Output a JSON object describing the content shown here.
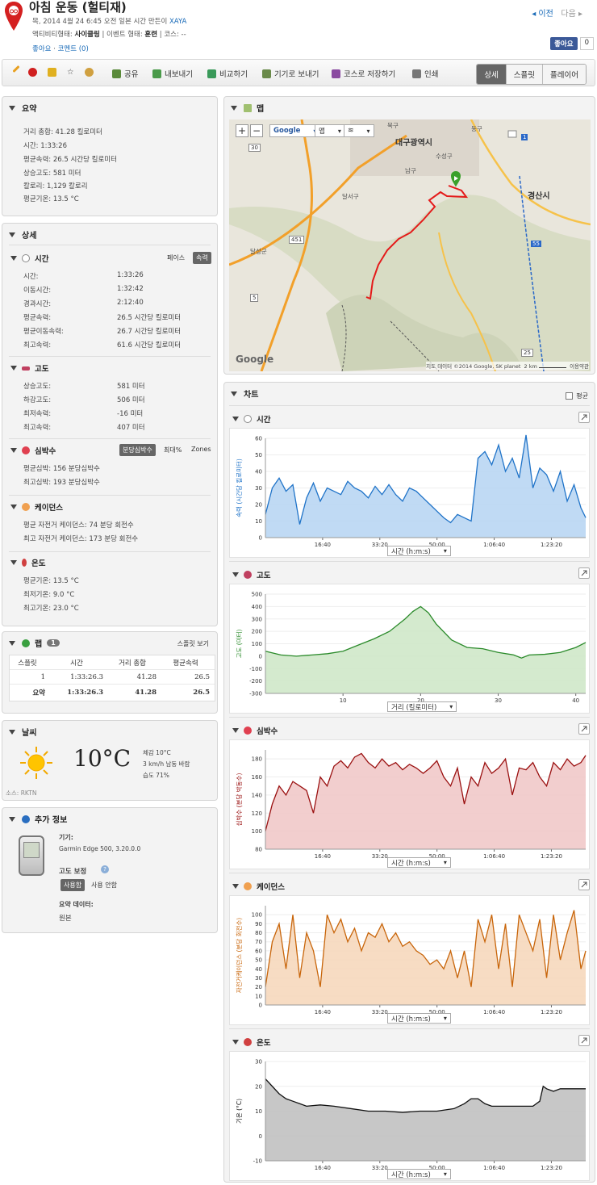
{
  "header": {
    "title": "아침 운동 (헐티재)",
    "date_line": "목, 2014 4월 24 6:45 오전 일본 시간 만든이 ",
    "author": "XAYA",
    "activity_label": "액티비티형태: ",
    "activity": "사이클링",
    "event_label": " | 이벤트 형태: ",
    "event": "훈련",
    "course": " | 코스: --",
    "like": "좋아요",
    "comments": "코멘트 (0)",
    "prev": "◂ 이전",
    "next": "다음 ▸",
    "fb_like": "좋아요",
    "fb_count": "0"
  },
  "toolbar": {
    "share": "공유",
    "export": "내보내기",
    "compare": "비교하기",
    "send": "기기로 보내기",
    "save_course": "코스로 저장하기",
    "print": "인쇄",
    "tabs": [
      "상세",
      "스플릿",
      "플레이어"
    ]
  },
  "summary": {
    "title": "요약",
    "rows": [
      "거리 총합:  41.28 킬로미터",
      "시간:  1:33:26",
      "평균속력:  26.5 시간당 킬로미터",
      "상승고도:  581 미터",
      "칼로리:  1,129 칼로리",
      "평균기온:  13.5 °C"
    ]
  },
  "detail": {
    "title": "상세",
    "time": {
      "title": "시간",
      "pace": "페이스",
      "speed": "속력",
      "labels": [
        "시간:",
        "이동시간:",
        "경과시간:",
        "평균속력:",
        "평균이동속력:",
        "최고속력:"
      ],
      "values": [
        "1:33:26",
        "1:32:42",
        "2:12:40",
        "26.5 시간당 킬로미터",
        "26.7 시간당 킬로미터",
        "61.6 시간당 킬로미터"
      ]
    },
    "elev": {
      "title": "고도",
      "labels": [
        "상승고도:",
        "하강고도:",
        "최저속력:",
        "최고속력:"
      ],
      "values": [
        "581 미터",
        "506 미터",
        "-16 미터",
        "407 미터"
      ]
    },
    "hr": {
      "title": "심박수",
      "bpm": "분당심박수",
      "max": "최대%",
      "zones": "Zones",
      "rows": [
        "평균심박:  156 분당심박수",
        "최고심박:  193 분당심박수"
      ]
    },
    "cad": {
      "title": "케이던스",
      "rows": [
        "평균 자전거 케이던스:  74 분당 회전수",
        "최고 자전거 케이던스:  173 분당 회전수"
      ]
    },
    "temp": {
      "title": "온도",
      "rows": [
        "평균기온:  13.5 °C",
        "최저기온:  9.0 °C",
        "최고기온:  23.0 °C"
      ]
    }
  },
  "laps": {
    "title": "랩",
    "count": "1",
    "split_view": "스플릿 보기",
    "headers": [
      "스플릿",
      "시간",
      "거리 총합",
      "평균속력"
    ],
    "row": [
      "1",
      "1:33:26.3",
      "41.28",
      "26.5"
    ],
    "total": [
      "요약",
      "1:33:26.3",
      "41.28",
      "26.5"
    ]
  },
  "weather": {
    "title": "날씨",
    "temp": "10°C",
    "feels": "체감 10°C",
    "wind": "3 km/h 남동 바람",
    "humidity": "습도 71%",
    "source": "소스: RKTN"
  },
  "extra": {
    "title": "추가 정보",
    "device_label": "기기:",
    "device": "Garmin Edge 500, 3.20.0.0",
    "elev_corr": "고도 보정",
    "use": "사용함",
    "nouse": "사용 안함",
    "summary_data": "요약 데이터:",
    "original": "원본"
  },
  "map": {
    "title": "맵",
    "google": "Google",
    "map_btn": "맵",
    "city": "대구광역시",
    "city2": "경산시",
    "copyright": "지도 데이터 ©2014 Google, SK planet",
    "scale": "2 km",
    "terms": "이용약관",
    "logo": "Google",
    "places": [
      "북구",
      "수성구",
      "남구",
      "달서구",
      "달성군",
      "동구"
    ],
    "roads": [
      "451",
      "30",
      "55",
      "5",
      "25",
      "1"
    ]
  },
  "charts": {
    "title": "차트",
    "avg": "평균",
    "speed": {
      "title": "시간",
      "ylabel": "속력 (시간당 킬로미터)",
      "xlabel": "시간 (h:m:s)"
    },
    "elev": {
      "title": "고도",
      "ylabel": "고도 (미터)",
      "xlabel": "거리 (킬로미터)"
    },
    "hr": {
      "title": "심박수",
      "ylabel": "심박수 (분당 박동수)",
      "xlabel": "시간 (h:m:s)"
    },
    "cad": {
      "title": "케이던스",
      "ylabel": "자전거케이던스 (분당 회전수)",
      "xlabel": "시간 (h:m:s)"
    },
    "temp": {
      "title": "온도",
      "ylabel": "기온 (°C)",
      "xlabel": "시간 (h:m:s)"
    }
  },
  "chart_data": [
    {
      "type": "area",
      "title": "시간",
      "ylabel": "속력 (시간당 킬로미터)",
      "xlabel": "시간 (h:m:s)",
      "xticks": [
        "16:40",
        "33:20",
        "50:00",
        "1:06:40",
        "1:23:20"
      ],
      "ylim": [
        0,
        60
      ],
      "yticks": [
        0,
        10,
        20,
        30,
        40,
        50,
        60
      ],
      "color": "#1f73c8",
      "fill": "#b5d4f2",
      "x": [
        0,
        2,
        4,
        6,
        8,
        10,
        12,
        14,
        16,
        18,
        20,
        22,
        24,
        26,
        28,
        30,
        32,
        34,
        36,
        38,
        40,
        42,
        44,
        46,
        48,
        50,
        52,
        54,
        56,
        58,
        60,
        62,
        64,
        66,
        68,
        70,
        72,
        74,
        76,
        78,
        80,
        82,
        84,
        86,
        88,
        90,
        92,
        93.4
      ],
      "values": [
        14,
        30,
        36,
        28,
        32,
        8,
        24,
        33,
        22,
        30,
        28,
        26,
        34,
        30,
        28,
        24,
        31,
        26,
        32,
        26,
        22,
        30,
        28,
        24,
        20,
        16,
        12,
        9,
        14,
        12,
        10,
        48,
        52,
        44,
        56,
        40,
        48,
        36,
        62,
        30,
        42,
        38,
        28,
        40,
        22,
        32,
        18,
        12
      ]
    },
    {
      "type": "area",
      "title": "고도",
      "ylabel": "고도 (미터)",
      "xlabel": "거리 (킬로미터)",
      "xticks": [
        10,
        20,
        30,
        40
      ],
      "ylim": [
        -300,
        500
      ],
      "yticks": [
        -300,
        -200,
        -100,
        0,
        100,
        200,
        300,
        400,
        500
      ],
      "color": "#2a8a2a",
      "fill": "#cde6c6",
      "x": [
        0,
        2,
        4,
        6,
        8,
        10,
        12,
        14,
        16,
        18,
        19,
        20,
        21,
        22,
        24,
        26,
        28,
        30,
        32,
        33,
        34,
        36,
        38,
        40,
        41.28
      ],
      "values": [
        40,
        10,
        0,
        10,
        20,
        40,
        90,
        140,
        200,
        300,
        360,
        400,
        350,
        260,
        130,
        70,
        60,
        30,
        10,
        -15,
        10,
        15,
        30,
        70,
        110
      ]
    },
    {
      "type": "area",
      "title": "심박수",
      "ylabel": "심박수 (분당 박동수)",
      "xlabel": "시간 (h:m:s)",
      "xticks": [
        "16:40",
        "33:20",
        "50:00",
        "1:06:40",
        "1:23:20"
      ],
      "ylim": [
        80,
        190
      ],
      "yticks": [
        80,
        100,
        120,
        140,
        160,
        180
      ],
      "color": "#9a1010",
      "fill": "#f0c6c6",
      "x": [
        0,
        2,
        4,
        6,
        8,
        10,
        12,
        14,
        16,
        18,
        20,
        22,
        24,
        26,
        28,
        30,
        32,
        34,
        36,
        38,
        40,
        42,
        44,
        46,
        48,
        50,
        52,
        54,
        56,
        58,
        60,
        62,
        64,
        66,
        68,
        70,
        72,
        74,
        76,
        78,
        80,
        82,
        84,
        86,
        88,
        90,
        92,
        93.4
      ],
      "values": [
        100,
        130,
        150,
        140,
        155,
        150,
        145,
        120,
        160,
        150,
        172,
        178,
        170,
        182,
        186,
        176,
        170,
        180,
        172,
        176,
        168,
        174,
        170,
        164,
        170,
        178,
        160,
        150,
        170,
        130,
        160,
        150,
        176,
        164,
        170,
        180,
        140,
        170,
        168,
        176,
        160,
        150,
        176,
        168,
        180,
        172,
        176,
        184
      ]
    },
    {
      "type": "area",
      "title": "케이던스",
      "ylabel": "자전거케이던스 (분당 회전수)",
      "xlabel": "시간 (h:m:s)",
      "xticks": [
        "16:40",
        "33:20",
        "50:00",
        "1:06:40",
        "1:23:20"
      ],
      "ylim": [
        0,
        110
      ],
      "yticks": [
        0,
        10,
        20,
        30,
        40,
        50,
        60,
        70,
        80,
        90,
        100
      ],
      "color": "#c8650a",
      "fill": "#f6d6b8",
      "x": [
        0,
        2,
        4,
        6,
        8,
        10,
        12,
        14,
        16,
        18,
        20,
        22,
        24,
        26,
        28,
        30,
        32,
        34,
        36,
        38,
        40,
        42,
        44,
        46,
        48,
        50,
        52,
        54,
        56,
        58,
        60,
        62,
        64,
        66,
        68,
        70,
        72,
        74,
        76,
        78,
        80,
        82,
        84,
        86,
        88,
        90,
        92,
        93.4
      ],
      "values": [
        20,
        70,
        90,
        40,
        100,
        30,
        80,
        60,
        20,
        100,
        80,
        95,
        70,
        85,
        60,
        80,
        75,
        90,
        70,
        80,
        65,
        70,
        60,
        55,
        45,
        50,
        40,
        60,
        30,
        60,
        20,
        95,
        70,
        100,
        40,
        90,
        20,
        100,
        80,
        60,
        95,
        30,
        100,
        50,
        80,
        105,
        40,
        60
      ]
    },
    {
      "type": "area",
      "title": "온도",
      "ylabel": "기온 (°C)",
      "xlabel": "시간 (h:m:s)",
      "xticks": [
        "16:40",
        "33:20",
        "50:00",
        "1:06:40",
        "1:23:20"
      ],
      "ylim": [
        -10,
        30
      ],
      "yticks": [
        -10,
        0,
        10,
        20,
        30
      ],
      "color": "#111111",
      "fill": "#bdbdbd",
      "x": [
        0,
        2,
        4,
        6,
        8,
        10,
        12,
        16,
        20,
        25,
        30,
        35,
        40,
        45,
        50,
        55,
        58,
        60,
        62,
        64,
        66,
        70,
        74,
        78,
        80,
        81,
        82,
        84,
        86,
        88,
        90,
        92,
        93.4
      ],
      "values": [
        23,
        20,
        17,
        15,
        14,
        13,
        12,
        12.5,
        12,
        11,
        10,
        10,
        9.5,
        10,
        10,
        11,
        13,
        15,
        15,
        13,
        12,
        12,
        12,
        12,
        14,
        20,
        19,
        18,
        19,
        19,
        19,
        19,
        19
      ]
    }
  ]
}
